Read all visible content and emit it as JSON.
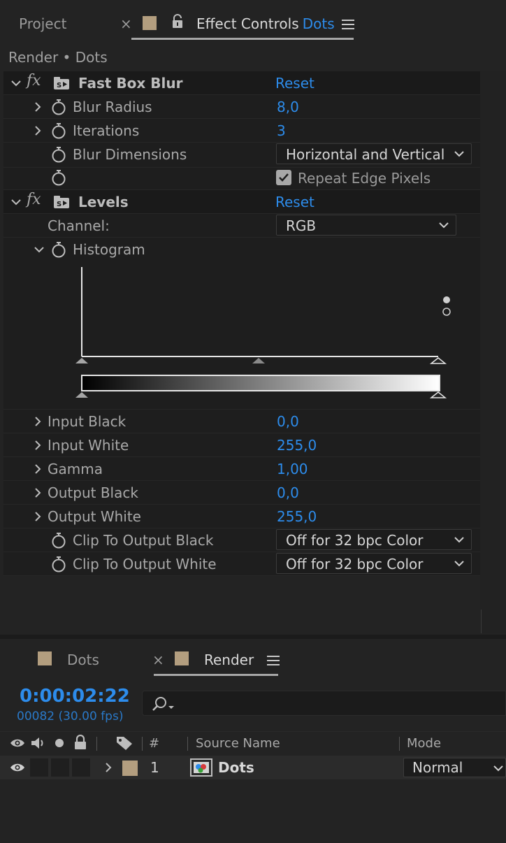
{
  "effect_controls_panel": {
    "tabs": {
      "project": "Project",
      "close": "×",
      "effect_controls": "Effect Controls",
      "effect_controls_layer": "Dots"
    },
    "breadcrumb": "Render • Dots",
    "effects": [
      {
        "name": "Fast Box Blur",
        "reset": "Reset",
        "params": {
          "blur_radius": {
            "label": "Blur Radius",
            "value": "8,0"
          },
          "iterations": {
            "label": "Iterations",
            "value": "3"
          },
          "blur_dimensions": {
            "label": "Blur Dimensions",
            "value": "Horizontal and Vertical"
          },
          "repeat_edge_pixels": {
            "label": "Repeat Edge Pixels",
            "checked": true
          }
        }
      },
      {
        "name": "Levels",
        "reset": "Reset",
        "params": {
          "channel": {
            "label": "Channel:",
            "value": "RGB"
          },
          "histogram": {
            "label": "Histogram"
          },
          "input_black": {
            "label": "Input Black",
            "value": "0,0"
          },
          "input_white": {
            "label": "Input White",
            "value": "255,0"
          },
          "gamma": {
            "label": "Gamma",
            "value": "1,00"
          },
          "output_black": {
            "label": "Output Black",
            "value": "0,0"
          },
          "output_white": {
            "label": "Output White",
            "value": "255,0"
          },
          "clip_output_black": {
            "label": "Clip To Output Black",
            "value": "Off for 32 bpc Color"
          },
          "clip_output_white": {
            "label": "Clip To Output White",
            "value": "Off for 32 bpc Color"
          }
        }
      }
    ]
  },
  "timeline_panel": {
    "tabs": {
      "dots": "Dots",
      "close": "×",
      "render": "Render"
    },
    "timecode": "0:00:02:22",
    "frame_info": "00082 (30.00 fps)",
    "search": {
      "value": "",
      "icon": "search-icon"
    },
    "columns": {
      "number": "#",
      "source_name": "Source Name",
      "mode": "Mode"
    },
    "layers": [
      {
        "index": "1",
        "name": "Dots",
        "mode": "Normal"
      }
    ]
  },
  "colors": {
    "accent_blue": "#2d8ceb",
    "label_tan": "#b39e7f",
    "panel_bg": "#232323"
  }
}
